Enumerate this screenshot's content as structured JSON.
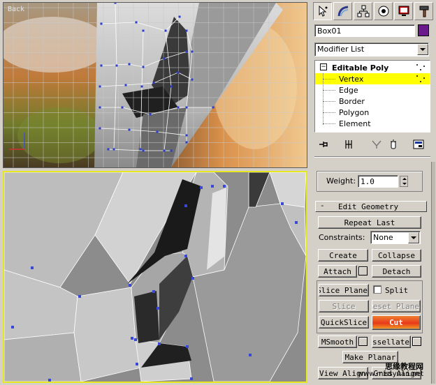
{
  "viewports": {
    "back": {
      "label": "Back"
    }
  },
  "command_panel": {
    "tabs": [
      {
        "name": "create",
        "icon": "cursor-star-icon"
      },
      {
        "name": "modify",
        "icon": "modify-arc-icon"
      },
      {
        "name": "hierarchy",
        "icon": "hierarchy-icon"
      },
      {
        "name": "motion",
        "icon": "motion-icon"
      },
      {
        "name": "display",
        "icon": "display-monitor-icon"
      },
      {
        "name": "utilities",
        "icon": "hammer-icon"
      }
    ],
    "object_name": "Box01",
    "object_color": "#6a1a8a",
    "modifier_list_label": "Modifier List",
    "stack": {
      "root": "Editable Poly",
      "items": [
        "Vertex",
        "Edge",
        "Border",
        "Polygon",
        "Element"
      ],
      "selected": "Vertex",
      "highlight_color": "#ffff00"
    },
    "weight": {
      "label": "Weight:",
      "value": "1.0"
    },
    "edit_geometry": {
      "title": "Edit Geometry",
      "repeat_last": "Repeat Last",
      "constraints_label": "Constraints:",
      "constraints_value": "None",
      "create": "Create",
      "collapse": "Collapse",
      "attach": "Attach",
      "detach": "Detach",
      "slice_plane": "Slice Plane",
      "split": "Split",
      "slice": "Slice",
      "reset_plane": "Reset Plane",
      "quickslice": "QuickSlice",
      "cut": "Cut",
      "msmooth": "MSmooth",
      "tessellate": "Tessellate",
      "make_planar": "Make Planar",
      "view_align": "View Align",
      "grid_align": "Grid Align"
    }
  },
  "watermark": {
    "cn": "思缘教程网",
    "url": "www.missyuan.net"
  }
}
